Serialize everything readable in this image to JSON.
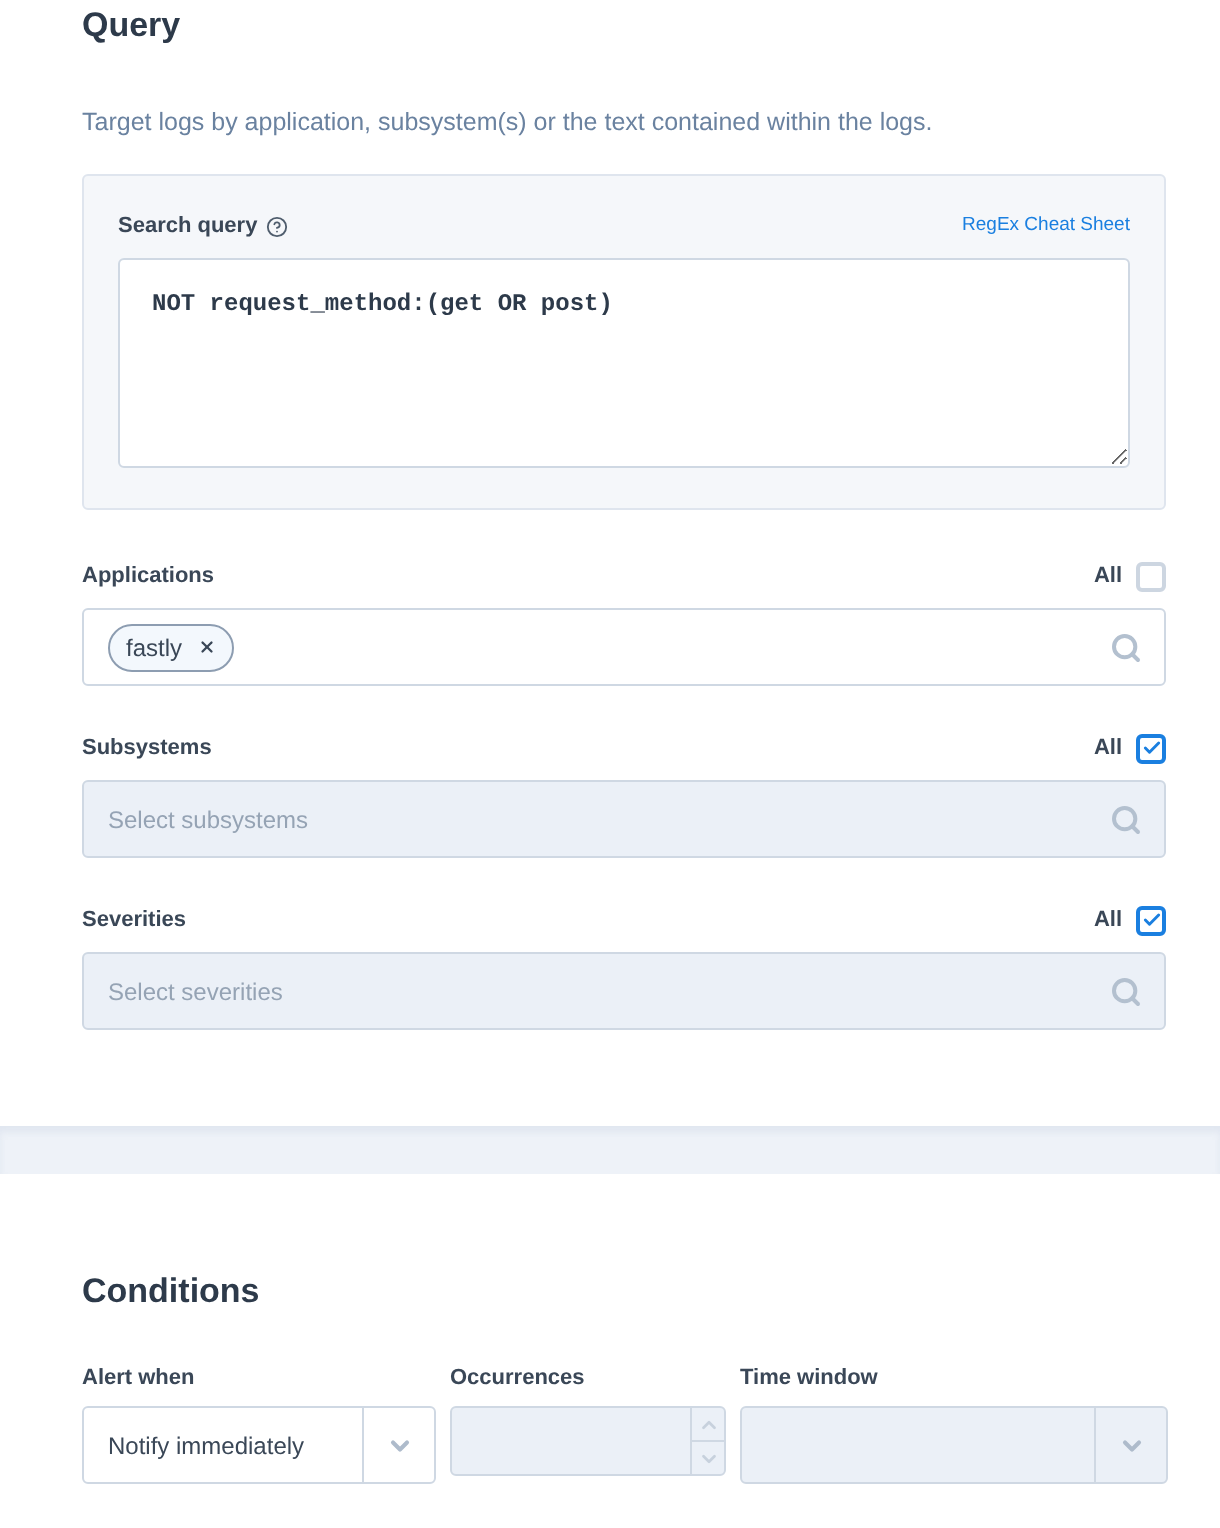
{
  "query": {
    "title": "Query",
    "description": "Target logs by application, subsystem(s) or the text contained within the logs.",
    "search": {
      "label": "Search query",
      "link": "RegEx Cheat Sheet",
      "value": "NOT request_method:(get OR post)"
    },
    "filters": [
      {
        "label": "Applications",
        "all_label": "All",
        "all_checked": false,
        "disabled": false,
        "chips": [
          {
            "label": "fastly"
          }
        ]
      },
      {
        "label": "Subsystems",
        "all_label": "All",
        "all_checked": true,
        "disabled": true,
        "placeholder": "Select subsystems"
      },
      {
        "label": "Severities",
        "all_label": "All",
        "all_checked": true,
        "disabled": true,
        "placeholder": "Select severities"
      }
    ]
  },
  "conditions": {
    "title": "Conditions",
    "fields": [
      {
        "kind": "select",
        "label": "Alert when",
        "value": "Notify immediately",
        "disabled": false
      },
      {
        "kind": "number",
        "label": "Occurrences",
        "disabled": true
      },
      {
        "kind": "select",
        "label": "Time window",
        "disabled": true
      }
    ]
  }
}
